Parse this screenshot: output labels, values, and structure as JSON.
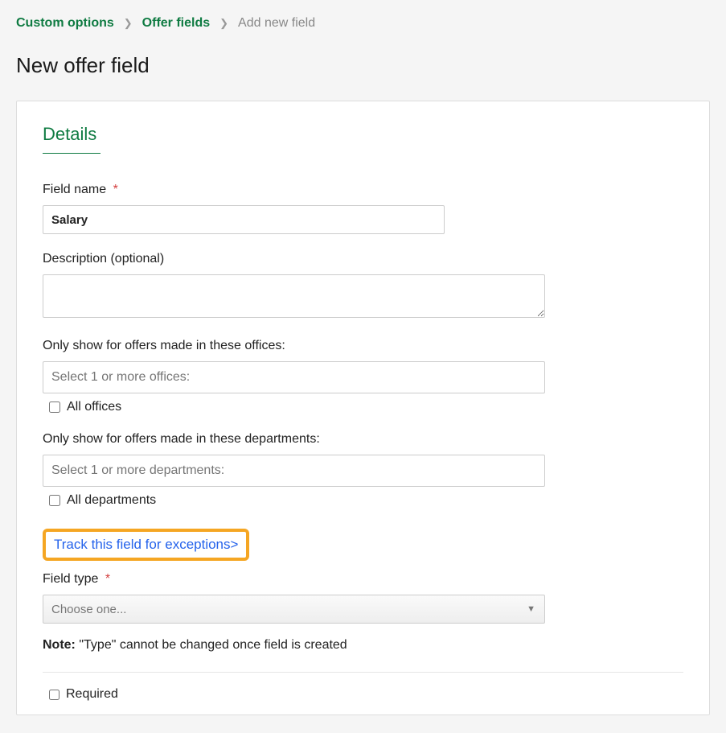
{
  "breadcrumb": {
    "item1": "Custom options",
    "item2": "Offer fields",
    "current": "Add new field"
  },
  "page_title": "New offer field",
  "section_title": "Details",
  "field_name": {
    "label": "Field name",
    "value": "Salary"
  },
  "description": {
    "label": "Description (optional)",
    "value": ""
  },
  "offices": {
    "label": "Only show for offers made in these offices:",
    "placeholder": "Select 1 or more offices:",
    "all_label": "All offices"
  },
  "departments": {
    "label": "Only show for offers made in these departments:",
    "placeholder": "Select 1 or more departments:",
    "all_label": "All departments"
  },
  "track_link": "Track this field for exceptions>",
  "field_type": {
    "label": "Field type",
    "placeholder": "Choose one..."
  },
  "note": {
    "label": "Note:",
    "text": "\"Type\" cannot be changed once field is created"
  },
  "required_label": "Required"
}
